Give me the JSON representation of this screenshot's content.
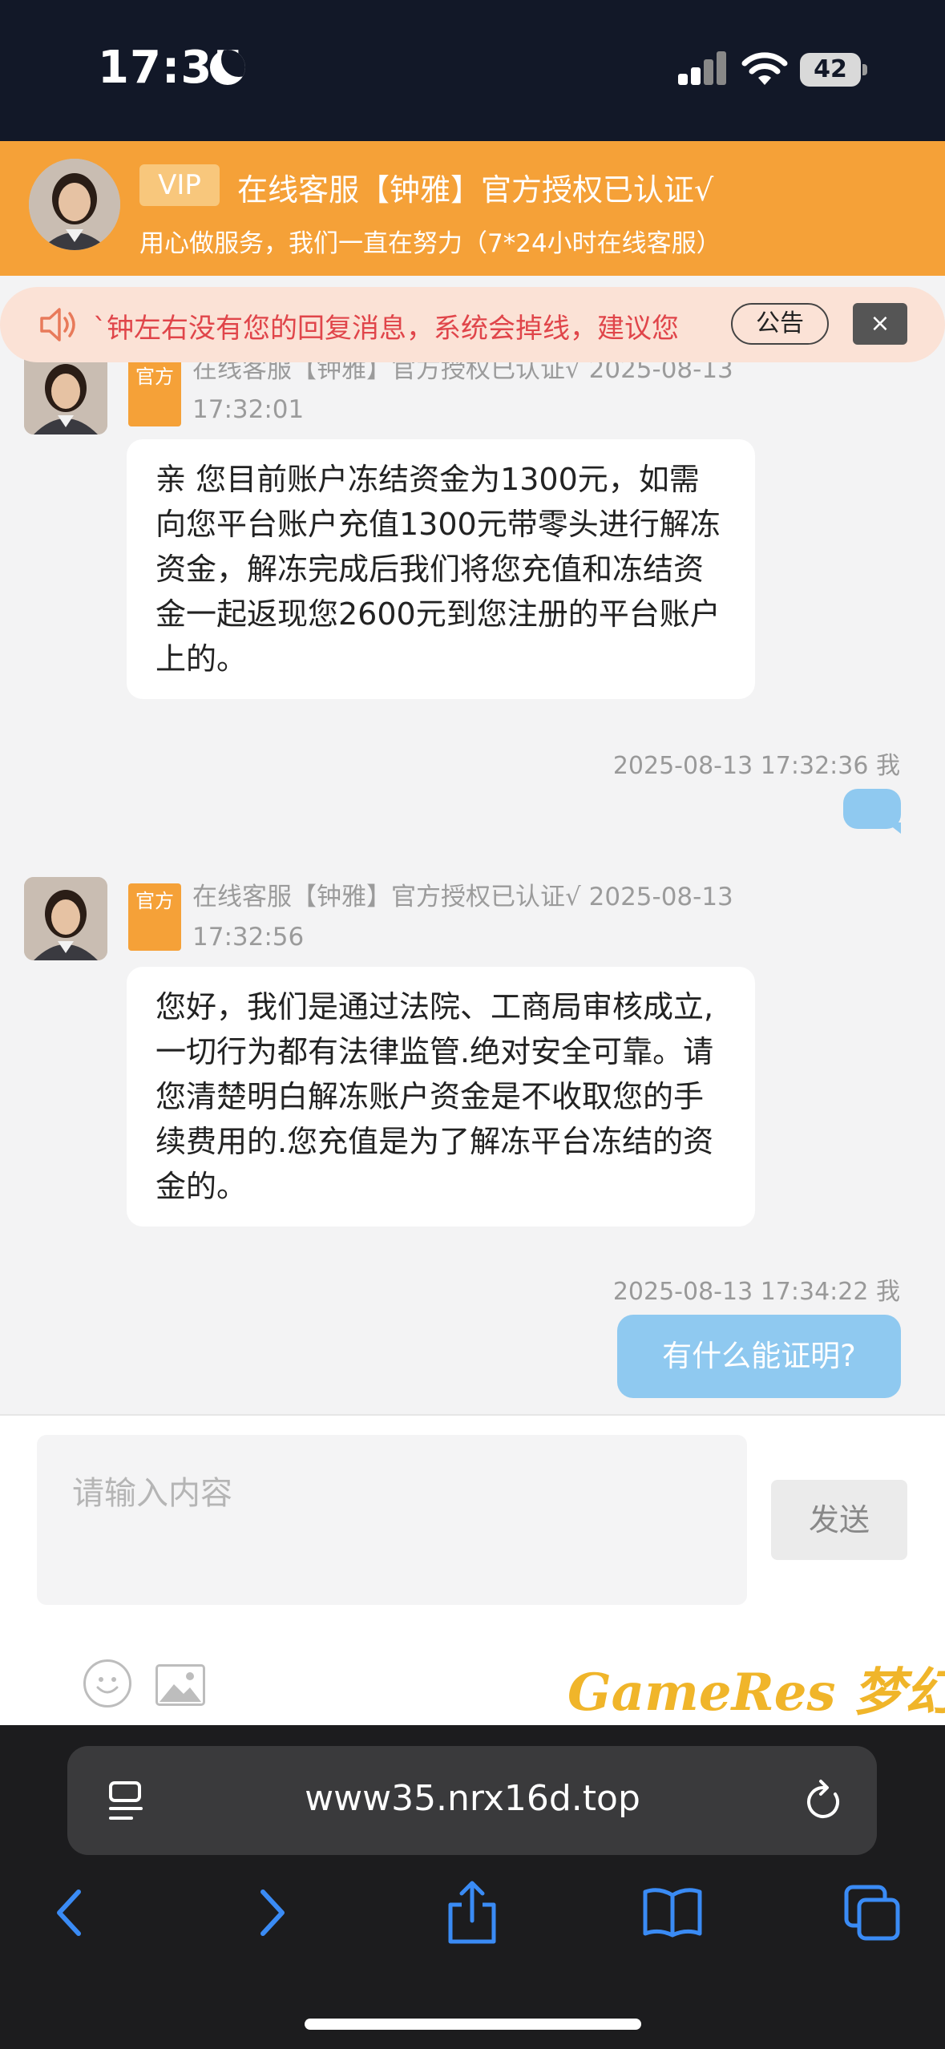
{
  "status_bar": {
    "time": "17:35",
    "battery": "42"
  },
  "header": {
    "vip_label": "VIP",
    "title": "在线客服【钟雅】官方授权已认证√",
    "subtitle": "用心做服务，我们一直在努力（7*24小时在线客服）"
  },
  "notice": {
    "text": "`钟左右没有您的回复消息，系统会掉线，建议您",
    "button_label": "公告",
    "close_label": "×"
  },
  "messages": [
    {
      "sender": "agent",
      "tag": "官方",
      "name": "在线客服【钟雅】官方授权已认证√",
      "timestamp": "2025-08-13 17:32:01",
      "text": "亲 您目前账户冻结资金为1300元，如需向您平台账户充值1300元带零头进行解冻资金，解冻完成后我们将您充值和冻结资金一起返现您2600元到您注册的平台账户上的。"
    },
    {
      "sender": "me",
      "timestamp": "2025-08-13 17:32:36",
      "me_label": "我",
      "text": ""
    },
    {
      "sender": "agent",
      "tag": "官方",
      "name": "在线客服【钟雅】官方授权已认证√",
      "timestamp": "2025-08-13 17:32:56",
      "text": "您好，我们是通过法院、工商局审核成立,一切行为都有法律监管.绝对安全可靠。请您清楚明白解冻账户资金是不收取您的手续费用的.您充值是为了解冻平台冻结的资金的。"
    },
    {
      "sender": "me",
      "timestamp": "2025-08-13 17:34:22",
      "me_label": "我",
      "text": "有什么能证明?"
    }
  ],
  "input": {
    "placeholder": "请输入内容",
    "send_label": "发送"
  },
  "watermark": "GameRes 梦幻",
  "browser": {
    "url": "www35.nrx16d.top"
  },
  "colors": {
    "header_bg": "#f5a138",
    "notice_text": "#e0454a",
    "my_bubble": "#8fc9f0",
    "browser_accent": "#3a8bf5"
  }
}
